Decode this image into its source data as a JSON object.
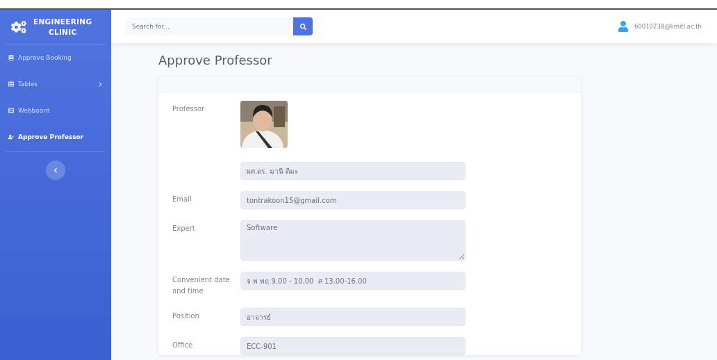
{
  "sidebar": {
    "brand": [
      "ENGINEERING",
      "CLINIC"
    ],
    "items": [
      {
        "label": "Approve Booking",
        "kind": "book",
        "selected": false,
        "has_children": false
      },
      {
        "label": "Tables",
        "kind": "table",
        "selected": false,
        "has_children": true
      },
      {
        "label": "Webboard",
        "kind": "board",
        "selected": false,
        "has_children": false
      },
      {
        "label": "Approve Professor",
        "kind": "user-check",
        "selected": true,
        "has_children": false
      }
    ]
  },
  "topbar": {
    "search": {
      "placeholder": "Search for..."
    },
    "user": "60010238@kmitl.ac.th"
  },
  "page_title": "Approve Professor",
  "form": {
    "photo": {
      "label": "Professor",
      "kind": "picture"
    },
    "fields": [
      {
        "value": "ผศ.ดร. มานี ดีมะ",
        "kind": "input"
      },
      {
        "label": "Email",
        "value": "tontrakoon15@gmail.com",
        "kind": "input"
      },
      {
        "label": "Expert",
        "value": "Software",
        "kind": "textarea"
      },
      {
        "label": "Convenient date and time",
        "value": "จ พ พฤ 9.00 - 10.00  ศ 13.00-16.00",
        "kind": "input"
      },
      {
        "label": "Position",
        "value": "อาจารย์",
        "kind": "input"
      },
      {
        "label": "Office",
        "value": "ECC-901",
        "kind": "input"
      }
    ]
  }
}
